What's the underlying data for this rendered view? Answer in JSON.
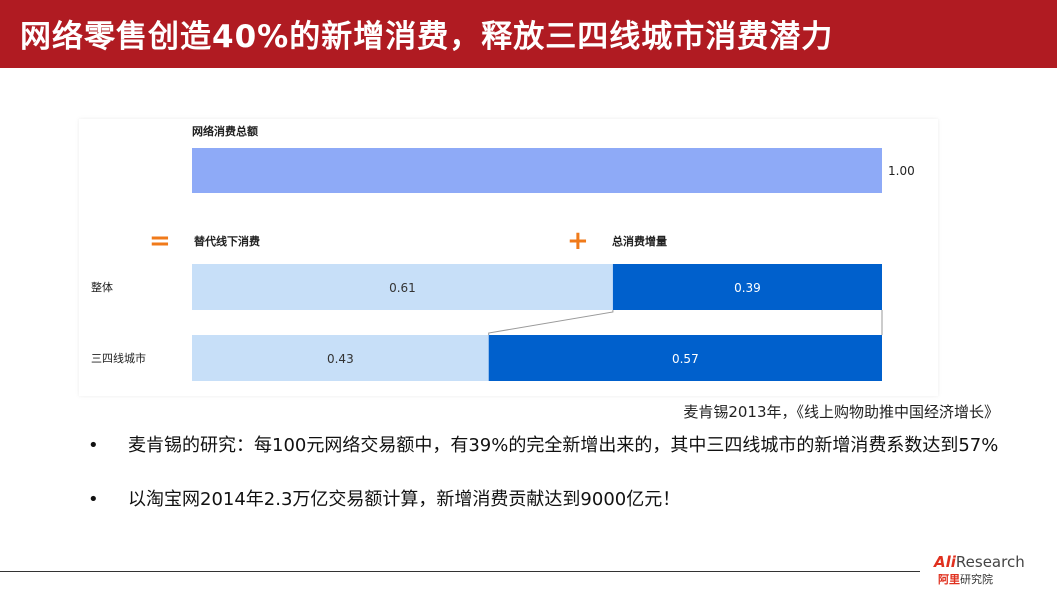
{
  "title": "网络零售创造40%的新增消费，释放三四线城市消费潜力",
  "source": "麦肯锡2013年，《线上购物助推中国经济增长》",
  "bullets": [
    {
      "dot": "•",
      "text": "麦肯锡的研究：每100元网络交易额中，有39%的完全新增出来的，其中三四线城市的新增消费系数达到57%"
    },
    {
      "dot": "•",
      "text": "以淘宝网2014年2.3万亿交易额计算，新增消费贡献达到9000亿元！"
    }
  ],
  "logo": {
    "ali": "Ali",
    "research": "Research",
    "cn_prefix": "阿里",
    "cn_suffix": "研究院"
  },
  "colors": {
    "title_bg": "#b01b22",
    "total": "#8eaaf7",
    "substitute": "#c7dff8",
    "incremental": "#0060cc",
    "symbol": "#f07a1a"
  },
  "chart_data": {
    "type": "bar",
    "total": {
      "label": "网络消费总额",
      "value": 1.0,
      "value_label": "1.00"
    },
    "legend": [
      {
        "symbol": "=",
        "name": "替代线下消费"
      },
      {
        "symbol": "+",
        "name": "总消费增量"
      }
    ],
    "categories": [
      "整体",
      "三四线城市"
    ],
    "series": [
      {
        "name": "替代线下消费",
        "values": [
          0.61,
          0.43
        ],
        "labels": [
          "0.61",
          "0.43"
        ]
      },
      {
        "name": "总消费增量",
        "values": [
          0.39,
          0.57
        ],
        "labels": [
          "0.39",
          "0.57"
        ]
      }
    ],
    "xlim": [
      0,
      1.0
    ],
    "grid": false
  }
}
